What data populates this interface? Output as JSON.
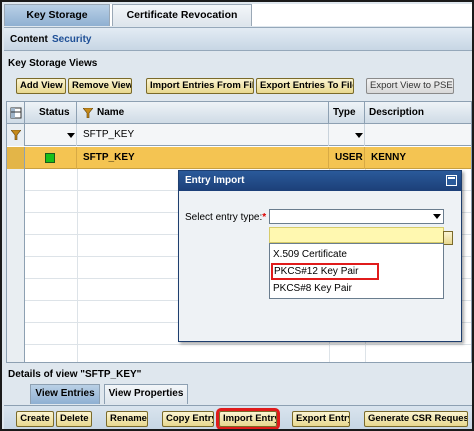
{
  "top_tabs": [
    {
      "label": "Key Storage",
      "active": true
    },
    {
      "label": "Certificate Revocation Check",
      "active": false
    }
  ],
  "header": {
    "content_label": "Content",
    "security_label": "Security"
  },
  "key_storage_views": {
    "title": "Key Storage Views",
    "buttons": {
      "add_view": "Add View",
      "remove_view": "Remove View",
      "import_entries": "Import Entries From File",
      "export_entries": "Export Entries To File",
      "export_view_pse": "Export View to PSE"
    }
  },
  "table": {
    "columns": {
      "status": "Status",
      "name": "Name",
      "type": "Type",
      "description": "Description"
    },
    "filter": {
      "name": "SFTP_KEY"
    },
    "rows": [
      {
        "name": "SFTP_KEY",
        "type": "USER",
        "description": "KENNY",
        "status": "green"
      }
    ]
  },
  "dialog": {
    "title": "Entry Import",
    "field_label": "Select entry type:",
    "required_mark": "*",
    "selected_value": "",
    "options": [
      "X.509 Certificate",
      "PKCS#12 Key Pair",
      "PKCS#8 Key Pair"
    ],
    "highlighted_option": "PKCS#12 Key Pair"
  },
  "details": {
    "title": "Details of view \"SFTP_KEY\"",
    "tabs": [
      {
        "label": "View Entries",
        "active": true
      },
      {
        "label": "View Properties",
        "active": false
      }
    ],
    "buttons": {
      "create": "Create",
      "delete": "Delete",
      "rename": "Rename",
      "copy_entry": "Copy Entry",
      "import_entry": "Import Entry",
      "export_entry": "Export Entry",
      "generate_csr": "Generate CSR Request"
    }
  },
  "colors": {
    "selected_row": "#f4c452",
    "highlight_outline": "#e01b1b",
    "status_ok": "#19c01a",
    "dialog_title": "#1c3f78"
  },
  "icons": [
    "settings-icon",
    "filter-icon",
    "sort-icon",
    "dropdown-icon",
    "status-green-icon",
    "maximize-icon"
  ]
}
